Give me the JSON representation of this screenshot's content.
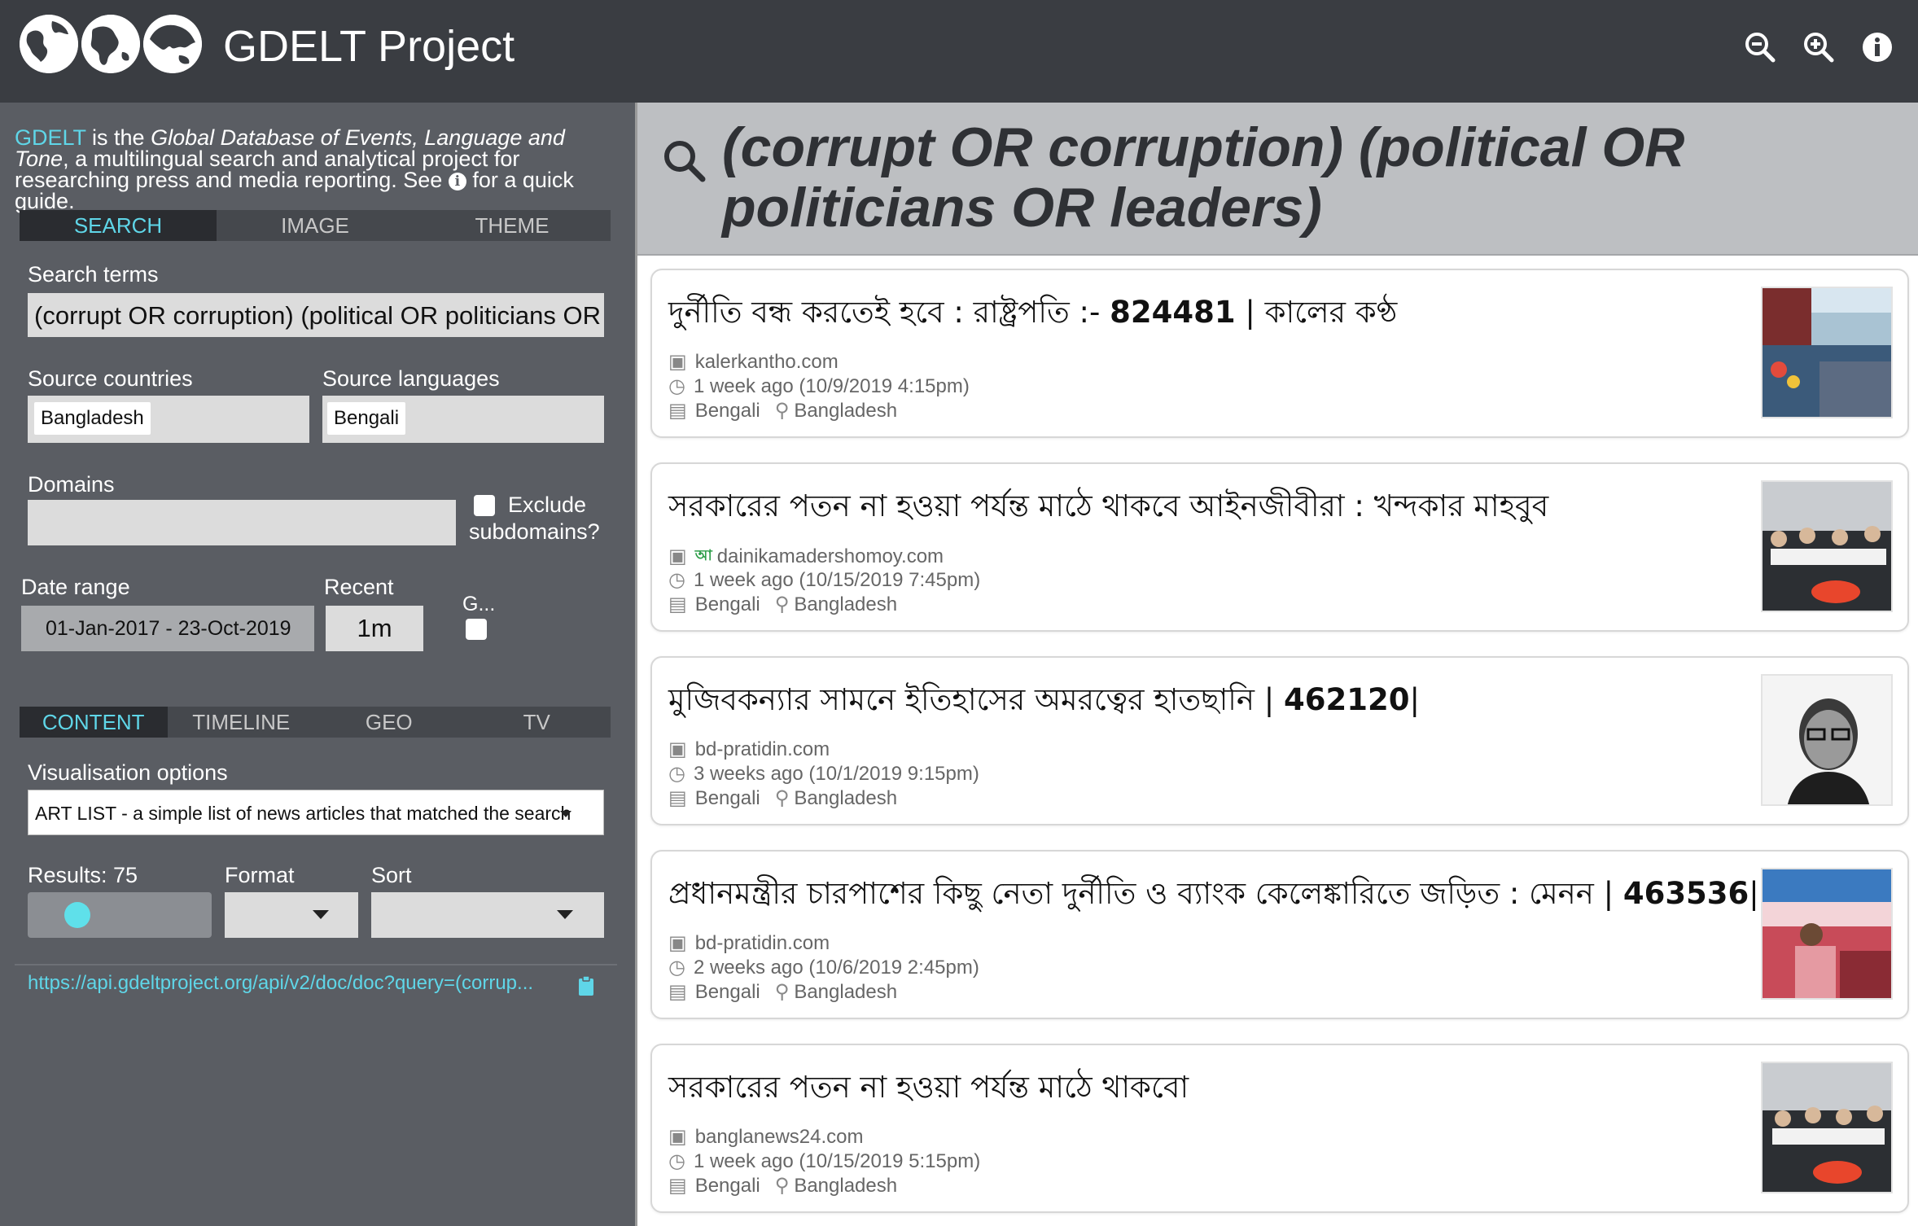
{
  "header": {
    "brand": "GDELT Project",
    "icons": [
      "zoom-out-icon",
      "zoom-in-icon",
      "info-icon"
    ]
  },
  "intro": {
    "gdelt": "GDELT",
    "part1": " is the ",
    "italic": "Global Database of Events, Language and Tone",
    "part2": ", a multilingual search and analytical project for researching press and media reporting. See ",
    "part3": " for a quick guide."
  },
  "top_tabs": [
    "SEARCH",
    "IMAGE",
    "THEME"
  ],
  "search": {
    "terms_label": "Search terms",
    "terms_value": "(corrupt OR corruption) (political OR politicians OR",
    "countries_label": "Source countries",
    "country_chip": "Bangladesh",
    "languages_label": "Source languages",
    "language_chip": "Bengali",
    "domains_label": "Domains",
    "exclude_label": "Exclude subdomains?",
    "date_label": "Date range",
    "date_value": "01-Jan-2017 - 23-Oct-2019",
    "recent_label": "Recent",
    "recent_value": "1m",
    "g_label": "G..."
  },
  "bottom_tabs": [
    "CONTENT",
    "TIMELINE",
    "GEO",
    "TV"
  ],
  "vis": {
    "label": "Visualisation options",
    "value": "ART LIST - a simple list of news articles that matched the search",
    "results_label": "Results: 75",
    "results_level": 0.2,
    "format_label": "Format",
    "sort_label": "Sort"
  },
  "api_url": "https://api.gdeltproject.org/api/v2/doc/doc?query=(corrup...",
  "query": "(corrupt OR corruption) (political OR politicians OR leaders)",
  "articles": [
    {
      "title": "দুর্নীতি বন্ধ করতেই হবে : রাষ্ট্রপতি :- ",
      "bold": "824481",
      "tail": " | কালের কণ্ঠ",
      "domain": "kalerkantho.com",
      "time": "1 week ago (10/9/2019 4:15pm)",
      "language": "Bengali",
      "country": "Bangladesh"
    },
    {
      "title": "সরকারের পতন না হওয়া পর্যন্ত মাঠে থাকবে আইনজীবীরা : খন্দকার মাহবুব",
      "bold": "",
      "tail": "",
      "domain": "dainikamadershomoy.com",
      "time": "1 week ago (10/15/2019 7:45pm)",
      "language": "Bengali",
      "country": "Bangladesh"
    },
    {
      "title": "মুজিবকন্যার সামনে ইতিহাসের অমরত্বের হাতছানি | ",
      "bold": "462120",
      "tail": "|",
      "domain": "bd-pratidin.com",
      "time": "3 weeks ago (10/1/2019 9:15pm)",
      "language": "Bengali",
      "country": "Bangladesh"
    },
    {
      "title": "প্রধানমন্ত্রীর চারপাশের কিছু নেতা দুর্নীতি ও ব্যাংক কেলেঙ্কারিতে জড়িত : মেনন | ",
      "bold": "463536",
      "tail": "|",
      "domain": "bd-pratidin.com",
      "time": "2 weeks ago (10/6/2019 2:45pm)",
      "language": "Bengali",
      "country": "Bangladesh"
    },
    {
      "title": "সরকারের পতন না হওয়া পর্যন্ত মাঠে থাকবো",
      "bold": "",
      "tail": "",
      "domain": "banglanews24.com",
      "time": "1 week ago (10/15/2019 5:15pm)",
      "language": "Bengali",
      "country": "Bangladesh"
    }
  ],
  "site_favicon_text": "আ",
  "colors": {
    "accent": "#5fd6e8",
    "header": "#3a3d42",
    "panel": "#5a5d63"
  }
}
